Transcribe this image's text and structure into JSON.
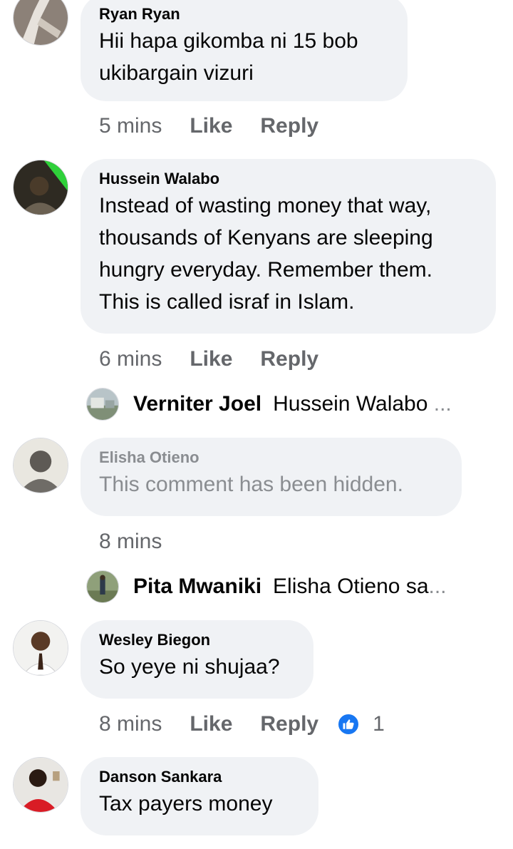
{
  "comments": [
    {
      "author": "Ryan Ryan",
      "text": [
        "Hii hapa gikomba ni 15 bob",
        "ukibargain vizuri"
      ],
      "time": "5 mins",
      "like": "Like",
      "reply": "Reply"
    },
    {
      "author": "Hussein Walabo",
      "text": [
        "Instead of wasting money that way,",
        "thousands of Kenyans are sleeping",
        "hungry everyday. Remember them.",
        "This is called israf in Islam."
      ],
      "time": "6 mins",
      "like": "Like",
      "reply": "Reply",
      "reply_preview": {
        "name": "Verniter Joel",
        "snippet": "Hussein Walabo",
        "ellipsis": "..."
      }
    },
    {
      "author": "Elisha Otieno",
      "text": [
        "This comment has been hidden."
      ],
      "time": "8 mins",
      "reply_preview": {
        "name": "Pita Mwaniki",
        "snippet": "Elisha Otieno sa",
        "ellipsis": "..."
      }
    },
    {
      "author": "Wesley Biegon",
      "text": [
        "So yeye ni shujaa?"
      ],
      "time": "8 mins",
      "like": "Like",
      "reply": "Reply",
      "reaction_count": "1"
    },
    {
      "author": "Danson Sankara",
      "text": [
        "Tax payers money"
      ]
    }
  ],
  "icons": {
    "reaction": "thumbs-up-icon"
  },
  "colors": {
    "bubble": "#f0f2f5",
    "meta": "#65676b",
    "hidden": "#8a8d91",
    "like_badge": "#1877f2"
  }
}
